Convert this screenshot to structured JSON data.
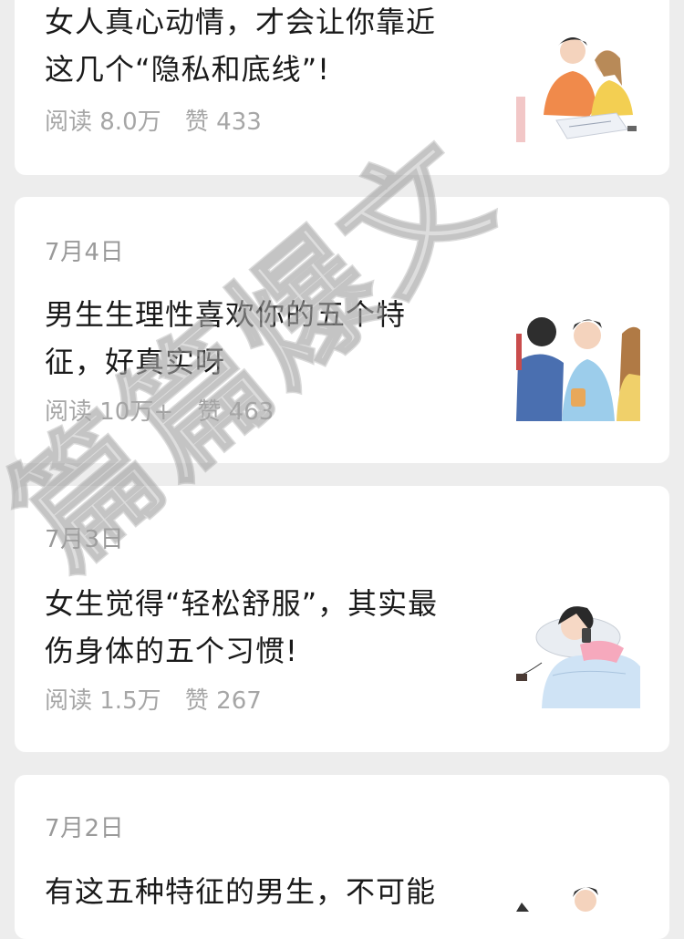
{
  "articles": [
    {
      "date": "",
      "title_line1": "女人真心动情，才会让你靠近",
      "title_line2": "这几个“隐私和底线”!",
      "reads": "阅读 8.0万",
      "likes": "赞 433",
      "thumb_icon": "couple-studying-illustration"
    },
    {
      "date": "7月4日",
      "title_line1": "男生生理性喜欢你的五个特",
      "title_line2": "征，好真实呀",
      "reads": "阅读 10万+",
      "likes": "赞 463",
      "thumb_icon": "friends-group-illustration"
    },
    {
      "date": "7月3日",
      "title_line1": "女生觉得“轻松舒服”，其实最",
      "title_line2": "伤身体的五个习惯!",
      "reads": "阅读 1.5万",
      "likes": "赞 267",
      "thumb_icon": "girl-lying-in-bed-illustration"
    },
    {
      "date": "7月2日",
      "title_line1": "有这五种特征的男生，不可能",
      "title_line2": "",
      "reads": "",
      "likes": "",
      "thumb_icon": "boy-portrait-illustration"
    }
  ],
  "watermark": "篇篇爆文"
}
